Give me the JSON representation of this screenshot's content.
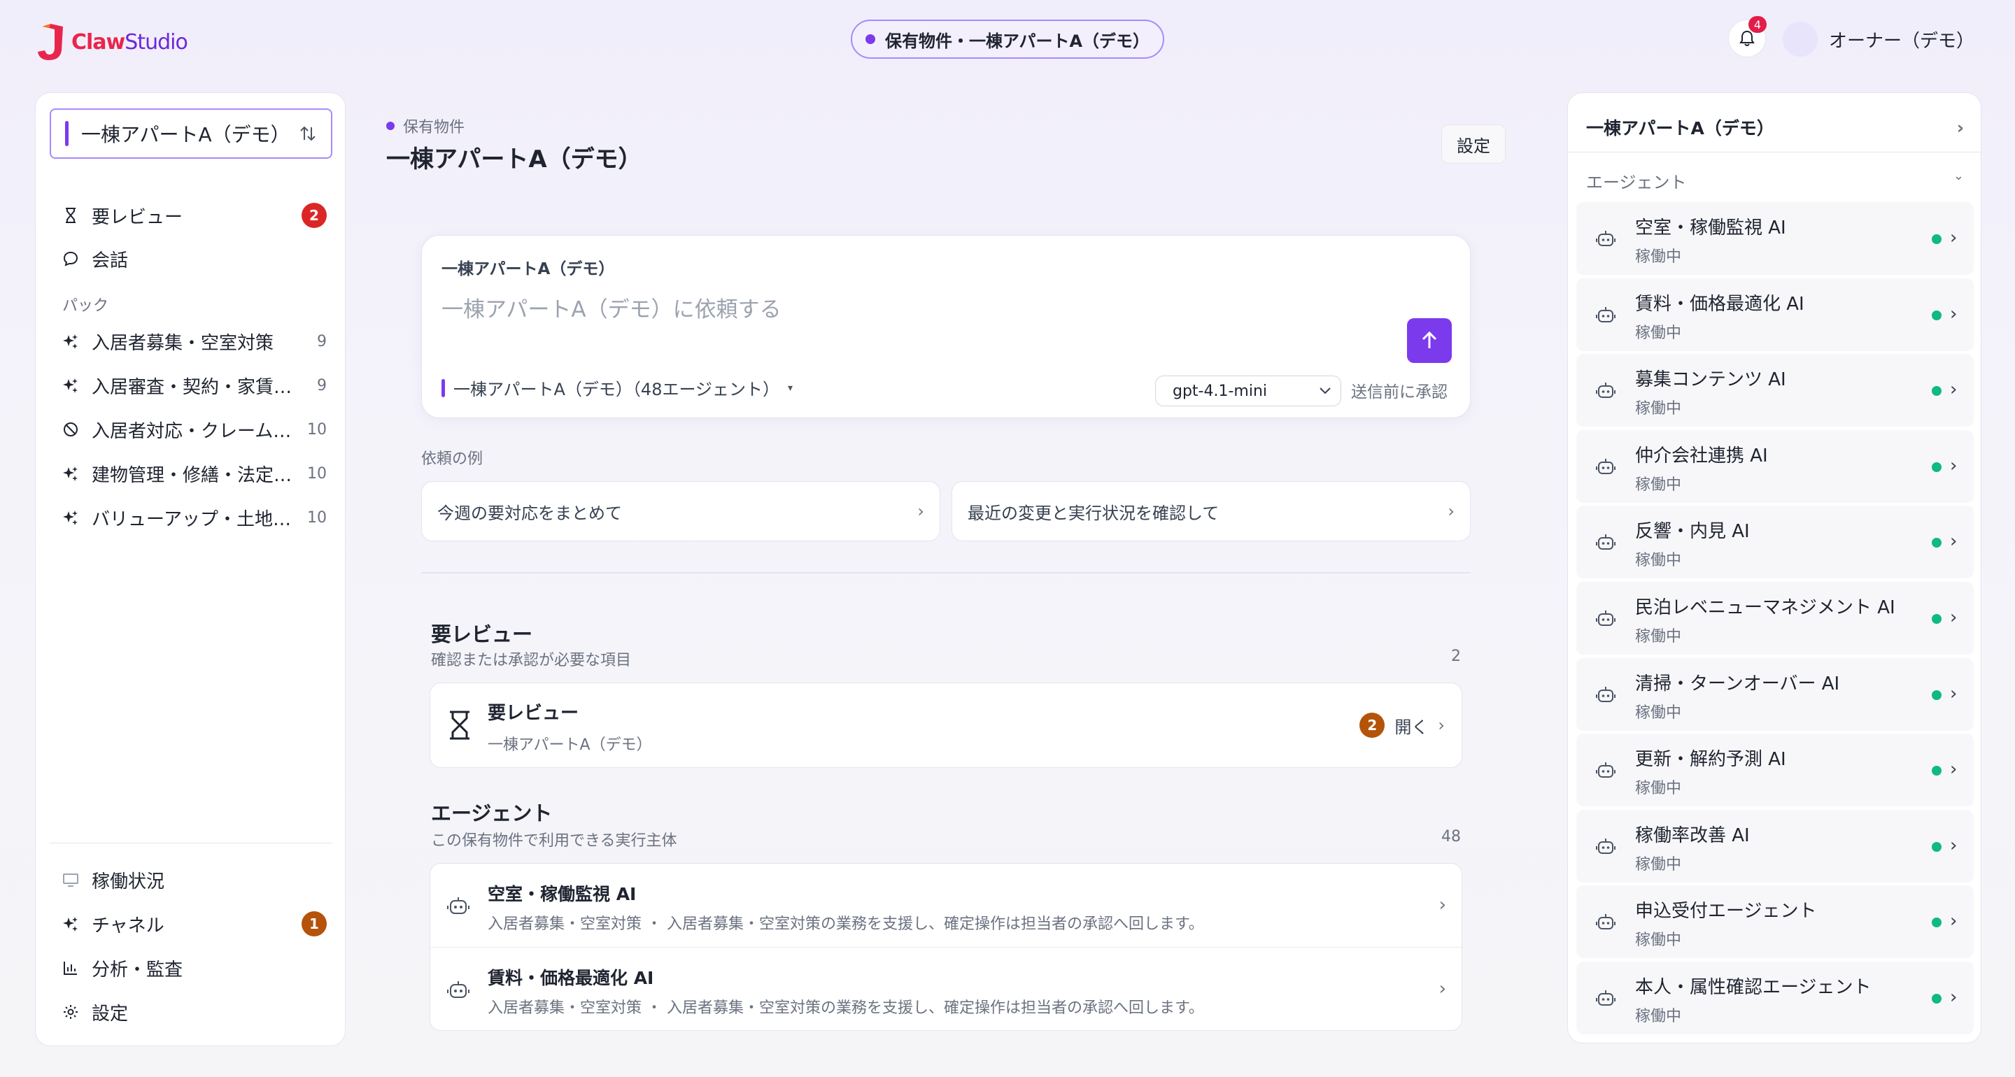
{
  "brand": {
    "name_part1": "Claw",
    "name_part2": "Studio"
  },
  "header": {
    "context_pill": "保有物件・一棟アパートA（デモ）",
    "notification_count": "4",
    "user_name": "オーナー（デモ）"
  },
  "sidebar": {
    "space_selector": "一棟アパートA（デモ）",
    "top_items": [
      {
        "label": "要レビュー",
        "badge": "2"
      },
      {
        "label": "会話"
      }
    ],
    "packs_label": "パック",
    "packs": [
      {
        "label": "入居者募集・空室対策",
        "count": "9"
      },
      {
        "label": "入居審査・契約・家賃管理",
        "count": "9"
      },
      {
        "label": "入居者対応・クレーム対応",
        "count": "10"
      },
      {
        "label": "建物管理・修繕・法定点検",
        "count": "10"
      },
      {
        "label": "バリューアップ・土地活用",
        "count": "10"
      }
    ],
    "bottom_items": [
      {
        "label": "稼働状況"
      },
      {
        "label": "チャネル",
        "badge": "1"
      },
      {
        "label": "分析・監査"
      },
      {
        "label": "設定"
      }
    ]
  },
  "main": {
    "breadcrumb": "保有物件",
    "title": "一棟アパートA（デモ）",
    "settings_label": "設定",
    "composer": {
      "context_label": "一棟アパートA（デモ）",
      "placeholder": "一棟アパートA（デモ）に依頼する",
      "scope_label": "一棟アパートA（デモ）（48エージェント）",
      "model": "gpt-4.1-mini",
      "approval_label": "送信前に承認"
    },
    "examples_label": "依頼の例",
    "examples": [
      "今週の要対応をまとめて",
      "最近の変更と実行状況を確認して"
    ],
    "review_section": {
      "title": "要レビュー",
      "subtitle": "確認または承認が必要な項目",
      "count": "2",
      "card_title": "要レビュー",
      "card_sub": "一棟アパートA（デモ）",
      "card_badge": "2",
      "card_open": "開く"
    },
    "agents_section": {
      "title": "エージェント",
      "subtitle": "この保有物件で利用できる実行主体",
      "count": "48",
      "rows": [
        {
          "name": "空室・稼働監視 AI",
          "desc": "入居者募集・空室対策 ・ 入居者募集・空室対策の業務を支援し、確定操作は担当者の承認へ回します。"
        },
        {
          "name": "賃料・価格最適化 AI",
          "desc": "入居者募集・空室対策 ・ 入居者募集・空室対策の業務を支援し、確定操作は担当者の承認へ回します。"
        }
      ]
    }
  },
  "right_panel": {
    "title": "一棟アパートA（デモ）",
    "agents_label": "エージェント",
    "agents": [
      {
        "name": "空室・稼働監視 AI",
        "status": "稼働中"
      },
      {
        "name": "賃料・価格最適化 AI",
        "status": "稼働中"
      },
      {
        "name": "募集コンテンツ AI",
        "status": "稼働中"
      },
      {
        "name": "仲介会社連携 AI",
        "status": "稼働中"
      },
      {
        "name": "反響・内見 AI",
        "status": "稼働中"
      },
      {
        "name": "民泊レベニューマネジメント AI",
        "status": "稼働中"
      },
      {
        "name": "清掃・ターンオーバー AI",
        "status": "稼働中"
      },
      {
        "name": "更新・解約予測 AI",
        "status": "稼働中"
      },
      {
        "name": "稼働率改善 AI",
        "status": "稼働中"
      },
      {
        "name": "申込受付エージェント",
        "status": "稼働中"
      },
      {
        "name": "本人・属性確認エージェント",
        "status": "稼働中"
      }
    ]
  },
  "colors": {
    "accent": "#7c3aed",
    "brand_red": "#e8264d",
    "status_green": "#10b981",
    "badge_red": "#dc2626",
    "badge_brown": "#b45309"
  }
}
